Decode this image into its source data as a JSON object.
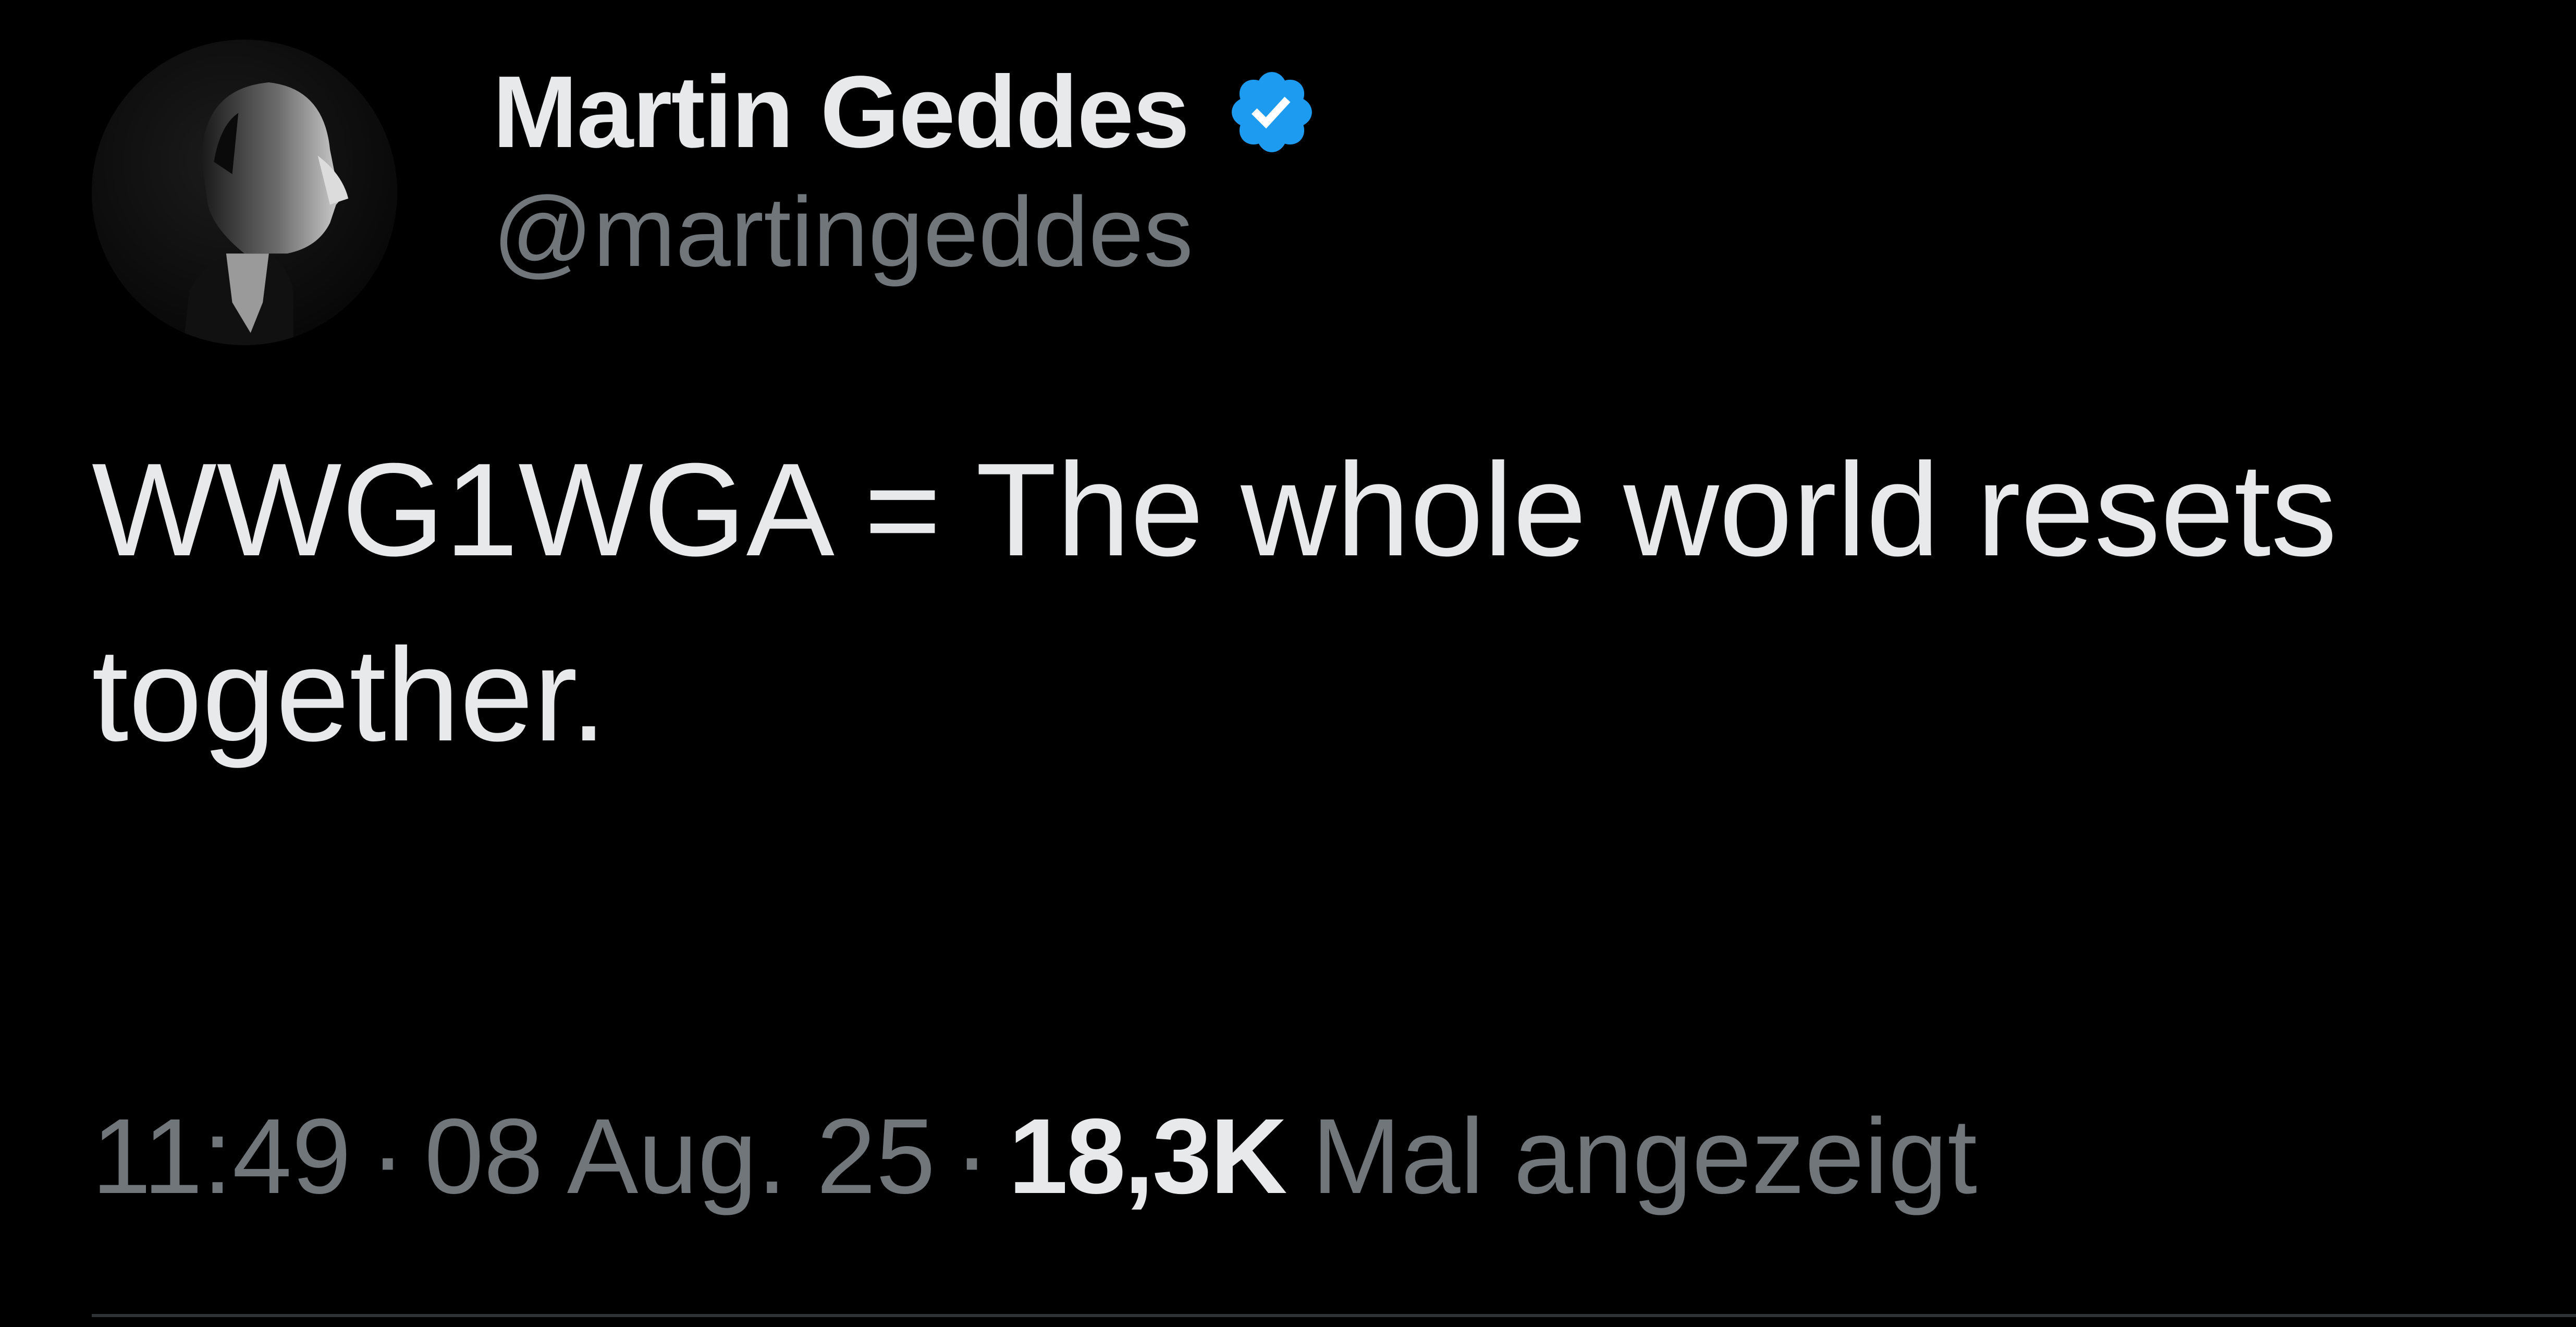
{
  "author": {
    "display_name": "Martin Geddes",
    "handle": "@martingeddes",
    "verified": true,
    "verified_icon": "verified-badge-icon",
    "verified_color": "#1d9bf0",
    "avatar": "profile-photo"
  },
  "tweet": {
    "text": "WWG1WGA = The whole world resets\ntogether."
  },
  "meta": {
    "time": "11:49",
    "separator": "·",
    "date": "08 Aug. 25",
    "views_count": "18,3K",
    "views_label": "Mal angezeigt"
  },
  "colors": {
    "background": "#000000",
    "primary_text": "#e7e9ea",
    "secondary_text": "#71767b",
    "divider": "#2f3336"
  }
}
